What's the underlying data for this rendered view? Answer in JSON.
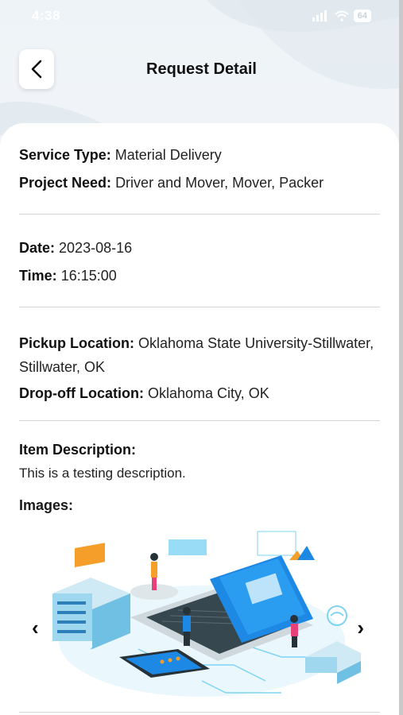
{
  "status_bar": {
    "time": "4:38",
    "battery": "64"
  },
  "header": {
    "title": "Request Detail"
  },
  "details": {
    "service_type_label": "Service Type:",
    "service_type_value": "Material Delivery",
    "project_need_label": "Project Need:",
    "project_need_value": "Driver and Mover, Mover, Packer",
    "date_label": "Date:",
    "date_value": "2023-08-16",
    "time_label": "Time:",
    "time_value": "16:15:00",
    "pickup_label": "Pickup Location:",
    "pickup_value": "Oklahoma State University-Stillwater, Stillwater, OK",
    "dropoff_label": "Drop-off Location:",
    "dropoff_value": "Oklahoma City, OK",
    "item_desc_label": "Item Description:",
    "item_desc_value": "This is a testing description.",
    "images_label": "Images:"
  },
  "carousel": {
    "prev_icon": "‹",
    "next_icon": "›"
  },
  "colors": {
    "accent_blue": "#1e88e5",
    "light_blue": "#7fd3f3",
    "orange": "#f59e2a",
    "pink": "#e8407a"
  }
}
